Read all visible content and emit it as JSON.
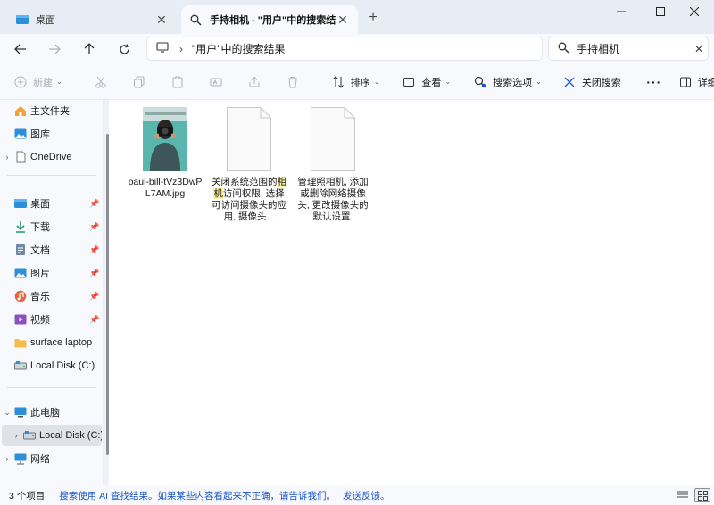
{
  "tabs": [
    {
      "label": "桌面",
      "active": false
    },
    {
      "label": "手持相机 - \"用户\"中的搜索结果",
      "active": true
    }
  ],
  "address": {
    "path": "\"用户\"中的搜索结果"
  },
  "search": {
    "value": "手持相机"
  },
  "toolbar": {
    "new_label": "新建",
    "sort_label": "排序",
    "view_label": "查看",
    "search_options_label": "搜索选项",
    "close_search_label": "关闭搜索",
    "details_label": "详细信息"
  },
  "sidebar": {
    "items": [
      {
        "label": "主文件夹",
        "icon": "home-icon"
      },
      {
        "label": "图库",
        "icon": "gallery-icon"
      },
      {
        "label": "OneDrive",
        "icon": "onedrive-icon"
      },
      {
        "label": "桌面",
        "icon": "desktop-icon"
      },
      {
        "label": "下载",
        "icon": "download-icon"
      },
      {
        "label": "文档",
        "icon": "document-icon"
      },
      {
        "label": "图片",
        "icon": "pictures-icon"
      },
      {
        "label": "音乐",
        "icon": "music-icon"
      },
      {
        "label": "视频",
        "icon": "video-icon"
      },
      {
        "label": "surface laptop",
        "icon": "folder-icon"
      },
      {
        "label": "Local Disk (C:)",
        "icon": "drive-icon"
      },
      {
        "label": "此电脑",
        "icon": "this-pc-icon"
      },
      {
        "label": "Local Disk (C:)",
        "icon": "drive-icon"
      },
      {
        "label": "网络",
        "icon": "network-icon"
      }
    ]
  },
  "files": [
    {
      "name": "paul-bill-tVz3DwPL7AM.jpg",
      "type": "image"
    },
    {
      "name_pre": "关闭系统范围的",
      "name_hl": "相机",
      "name_post": "访问权限, 选择可访问摄像头的应用, 摄像头...",
      "type": "setting"
    },
    {
      "name": "管理照相机, 添加或删除网络摄像头, 更改摄像头的默认设置.",
      "type": "setting"
    }
  ],
  "status": {
    "count": "3 个项目",
    "note": "搜索使用 AI 查找结果。如果某些内容看起来不正确，请告诉我们。",
    "feedback": "发送反馈。"
  },
  "colors": {
    "accent": "#1a56c9",
    "highlight": "#fff3a0",
    "folder": "#f2c04a"
  }
}
